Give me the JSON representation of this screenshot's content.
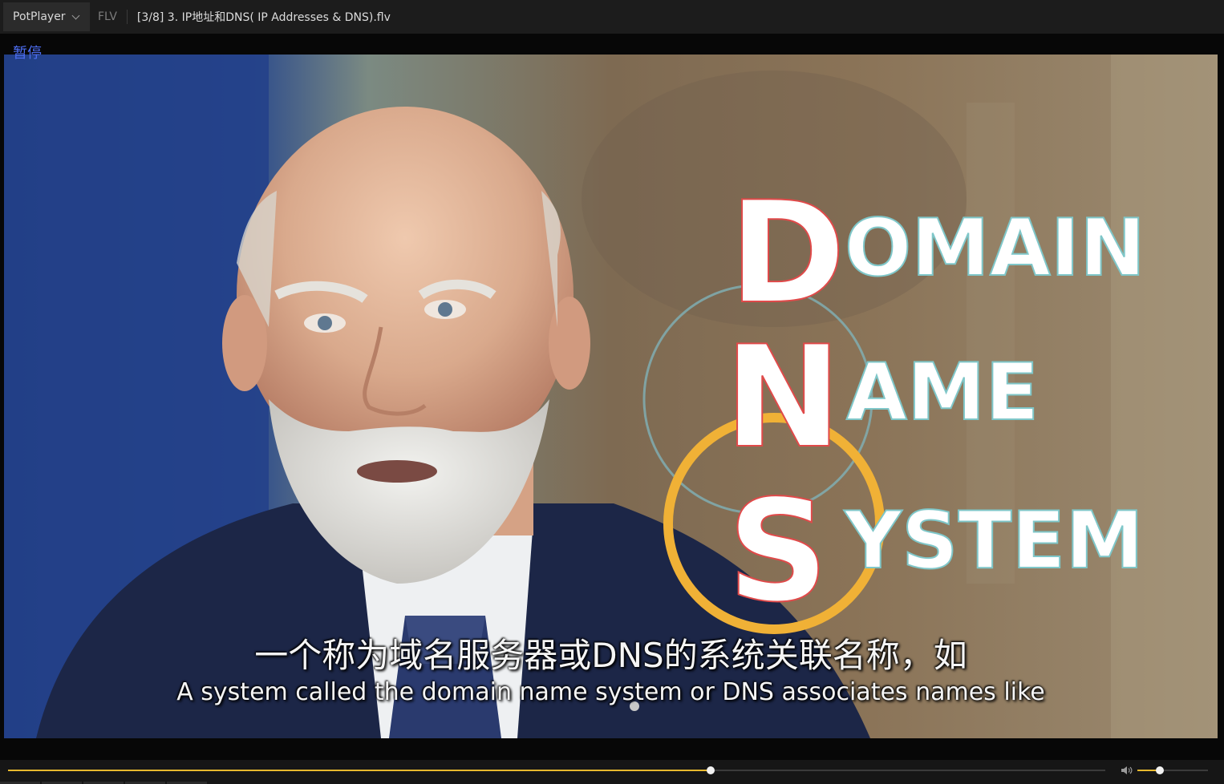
{
  "titlebar": {
    "app_name": "PotPlayer",
    "format": "FLV",
    "file_title": "[3/8] 3. IP地址和DNS( IP Addresses & DNS).flv"
  },
  "osd": {
    "status": "暂停"
  },
  "video": {
    "overlay": {
      "line1_initial": "D",
      "line1_rest": "OMAIN",
      "line2_initial": "N",
      "line2_rest": "AME",
      "line3_initial": "S",
      "line3_rest": "YSTEM"
    },
    "subtitle_cn": "一个称为域名服务器或DNS的系统关联名称，如",
    "subtitle_en": "A system called the domain name system or DNS associates names like"
  },
  "controls": {
    "seek_progress": 0.64,
    "volume_level": 0.32,
    "accent_color": "#e8b92e"
  },
  "icons": {
    "volume": "speaker-icon",
    "dropdown": "chevron-down-icon"
  }
}
